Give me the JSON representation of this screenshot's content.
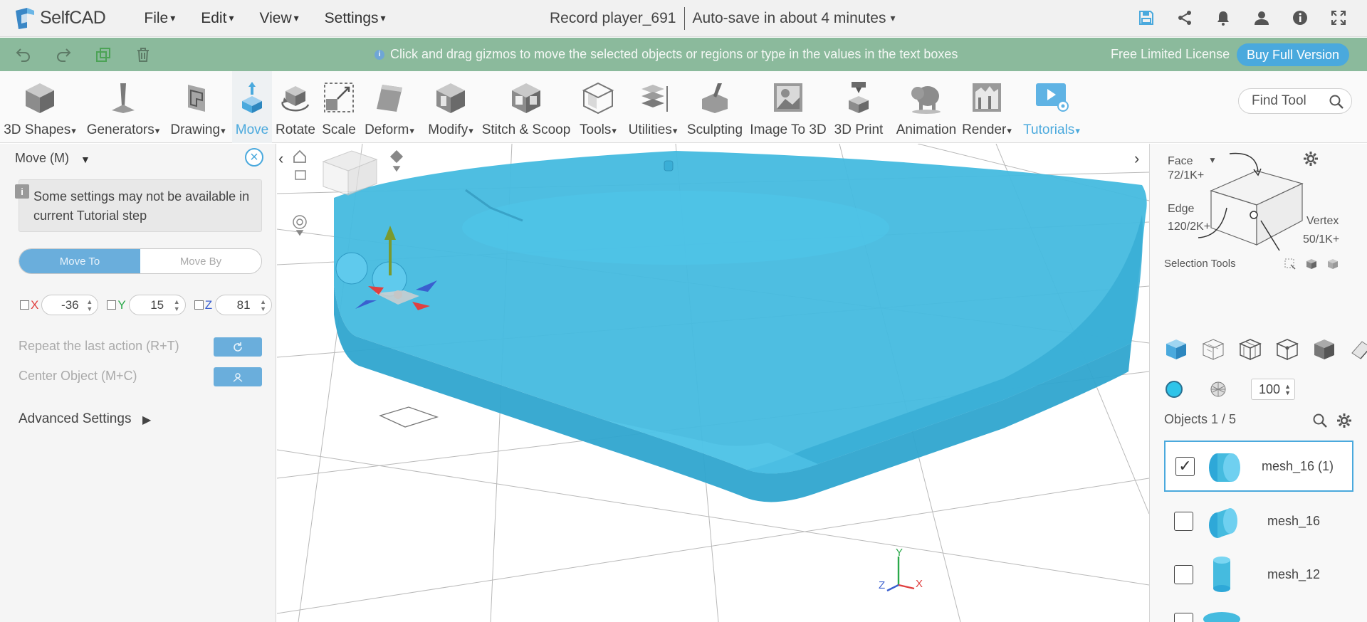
{
  "app": {
    "name": "SelfCAD",
    "menu": [
      "File",
      "Edit",
      "View",
      "Settings"
    ],
    "project_title": "Record player_691",
    "autosave": "Auto-save in about 4 minutes",
    "top_icons": [
      "save-icon",
      "share-icon",
      "bell-icon",
      "user-icon",
      "info-icon",
      "fullscreen-icon"
    ]
  },
  "greenbar": {
    "icons": [
      "undo-icon",
      "redo-icon",
      "copy-icon",
      "trash-icon"
    ],
    "hint": "Click and drag gizmos to move the selected objects or regions or type in the values in the text boxes",
    "license": "Free Limited License",
    "buy_label": "Buy Full Version",
    "accent": "#4aa9dd"
  },
  "toolbar": {
    "tools": [
      {
        "label": "3D Shapes"
      },
      {
        "label": "Generators"
      },
      {
        "label": "Drawing"
      },
      {
        "label": "Move"
      },
      {
        "label": "Rotate"
      },
      {
        "label": "Scale"
      },
      {
        "label": "Deform"
      },
      {
        "label": "Modify"
      },
      {
        "label": "Stitch & Scoop"
      },
      {
        "label": "Tools"
      },
      {
        "label": "Utilities"
      },
      {
        "label": "Sculpting"
      },
      {
        "label": "Image To 3D"
      },
      {
        "label": "3D Print"
      },
      {
        "label": "Animation"
      },
      {
        "label": "Render"
      },
      {
        "label": "Tutorials"
      }
    ],
    "find_placeholder": "Find Tool"
  },
  "left_panel": {
    "title": "Move (M)",
    "info": "Some settings may not be available in current Tutorial step",
    "mode_move_to": "Move To",
    "mode_move_by": "Move By",
    "x_label": "X",
    "x_value": "-36",
    "y_label": "Y",
    "y_value": "15",
    "z_label": "Z",
    "z_value": "81",
    "repeat_label": "Repeat the last action (R+T)",
    "center_label": "Center Object (M+C)",
    "advanced_label": "Advanced Settings"
  },
  "viewport": {
    "object_color": "#45bbdf",
    "axis_y": "Y",
    "axis_x": "X",
    "axis_z": "Z"
  },
  "right_panel": {
    "face_label": "Face",
    "face_count": "72/1K+",
    "edge_label": "Edge",
    "edge_count": "120/2K+",
    "vertex_label": "Vertex",
    "vertex_count": "50/1K+",
    "selection_tools_label": "Selection Tools",
    "opacity_value": "100",
    "objects_header": "Objects 1 / 5",
    "objects": [
      {
        "name": "mesh_16 (1)",
        "checked": true
      },
      {
        "name": "mesh_16",
        "checked": false
      },
      {
        "name": "mesh_12",
        "checked": false
      }
    ]
  }
}
